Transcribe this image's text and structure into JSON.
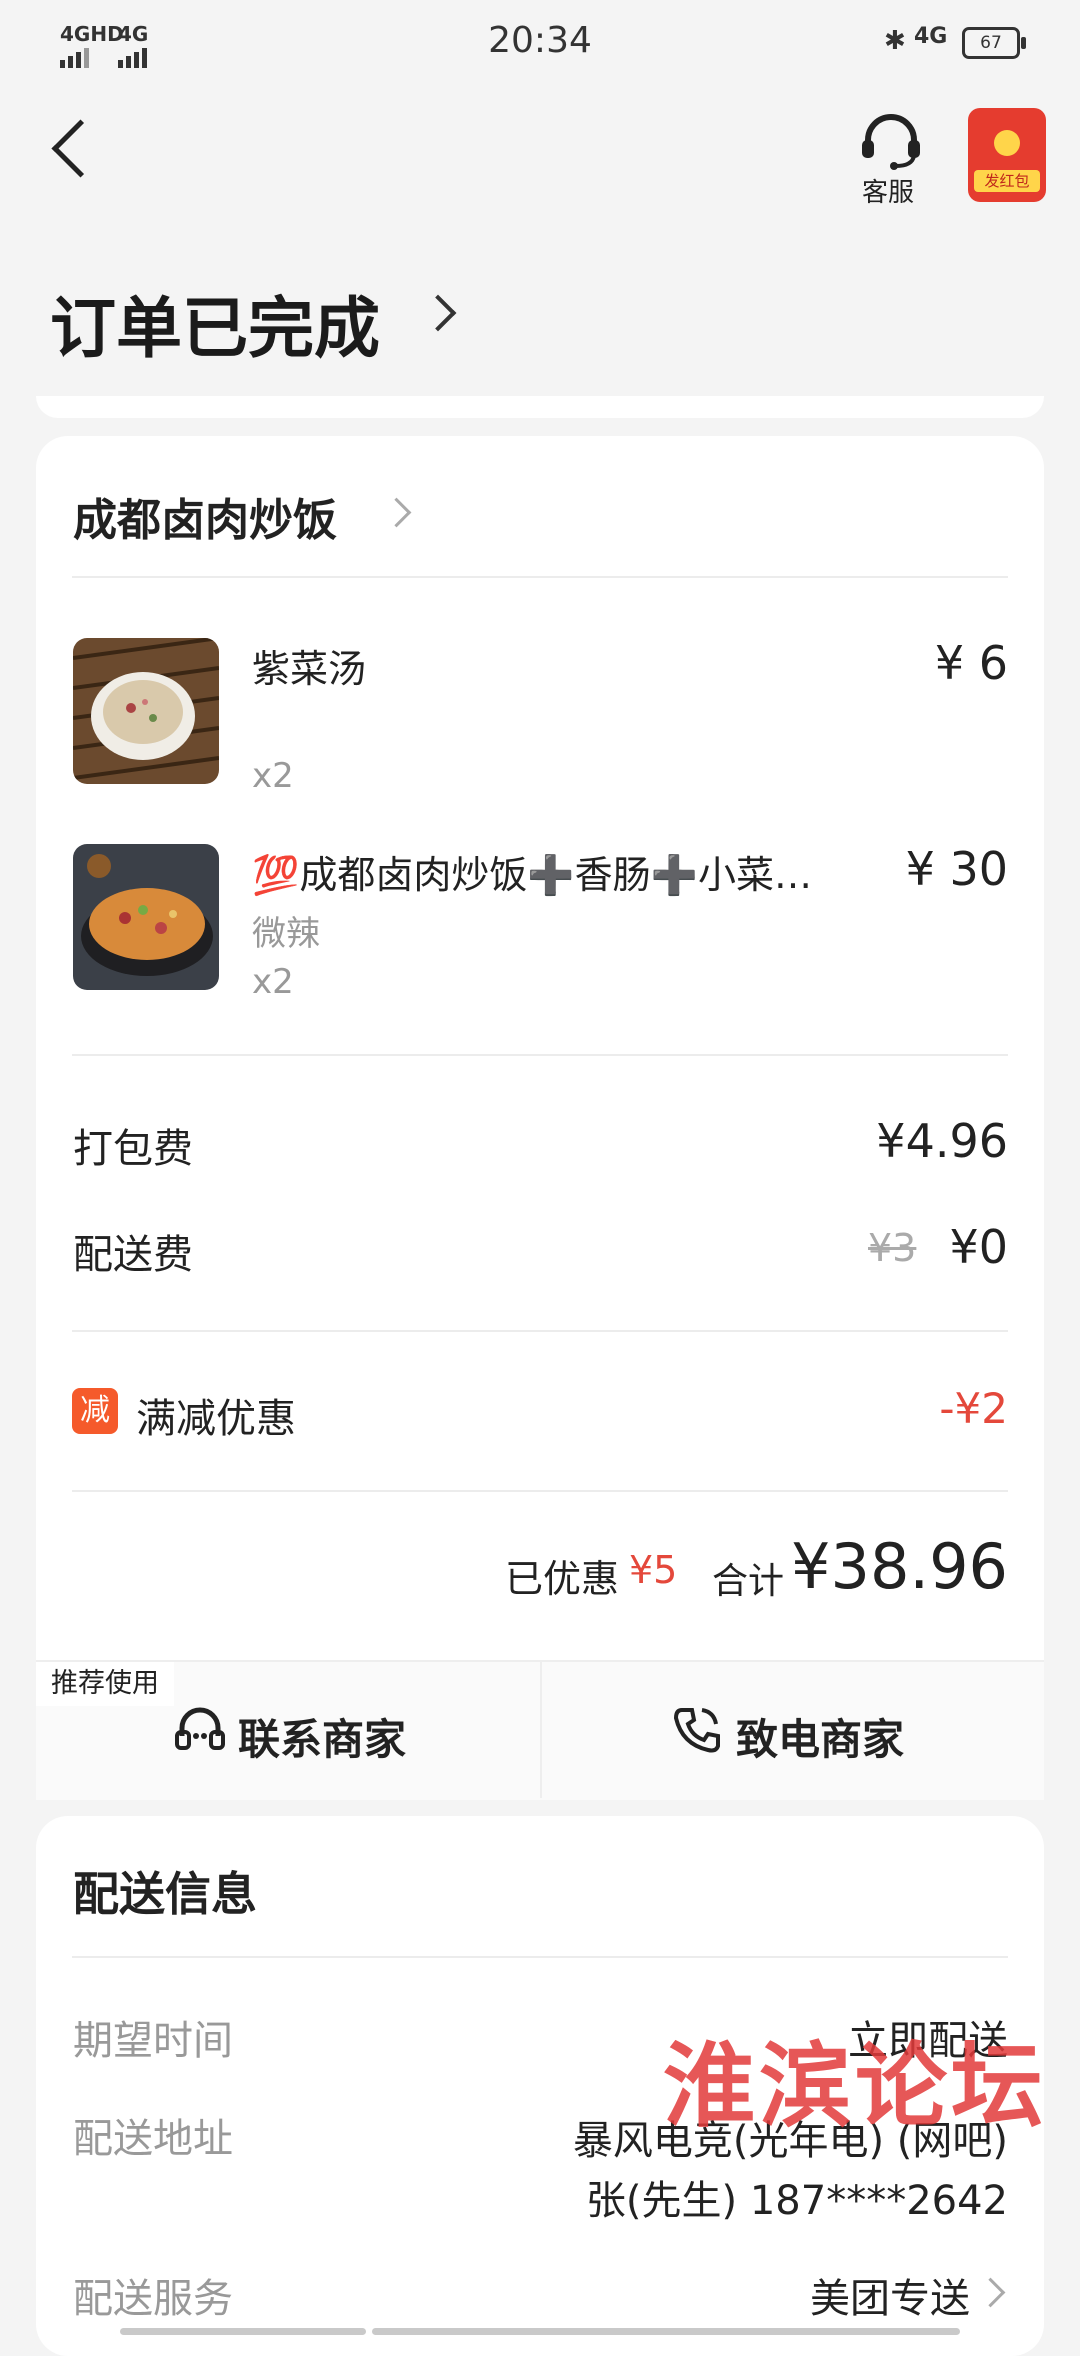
{
  "status_bar": {
    "signal1": "4GHD",
    "signal2": "4G",
    "time": "20:34",
    "network": "4G",
    "battery": "67"
  },
  "header": {
    "customer_service_label": "客服",
    "red_packet_label": "发红包"
  },
  "page_title": "订单已完成",
  "order": {
    "shop_name": "成都卤肉炒饭",
    "items": [
      {
        "name": "紫菜汤",
        "spec": "",
        "qty": "x2",
        "price": "¥ 6"
      },
      {
        "name": "💯成都卤肉炒饭➕香肠➕小菜…",
        "spec": "微辣",
        "qty": "x2",
        "price": "¥ 30"
      }
    ],
    "packing_fee_label": "打包费",
    "packing_fee_value": "¥4.96",
    "delivery_fee_label": "配送费",
    "delivery_fee_original": "¥3",
    "delivery_fee_value": "¥0",
    "discount_badge": "减",
    "discount_label": "满减优惠",
    "discount_value": "-¥2",
    "saved_label": "已优惠",
    "saved_value": "¥5",
    "total_label": "合计",
    "total_value": "¥38.96",
    "recommend_tag": "推荐使用",
    "contact_merchant_label": "联系商家",
    "call_merchant_label": "致电商家"
  },
  "delivery": {
    "section_title": "配送信息",
    "expected_time_label": "期望时间",
    "expected_time_value": "立即配送",
    "address_label": "配送地址",
    "address_line1": "暴风电竞(光年电) (网吧)",
    "address_line2": "张(先生)  187****2642",
    "service_label": "配送服务",
    "service_value": "美团专送"
  },
  "watermark": "淮滨论坛",
  "colors": {
    "accent_red": "#e4483b",
    "badge_orange": "#f55a2b",
    "red_packet": "#e53c2f"
  }
}
